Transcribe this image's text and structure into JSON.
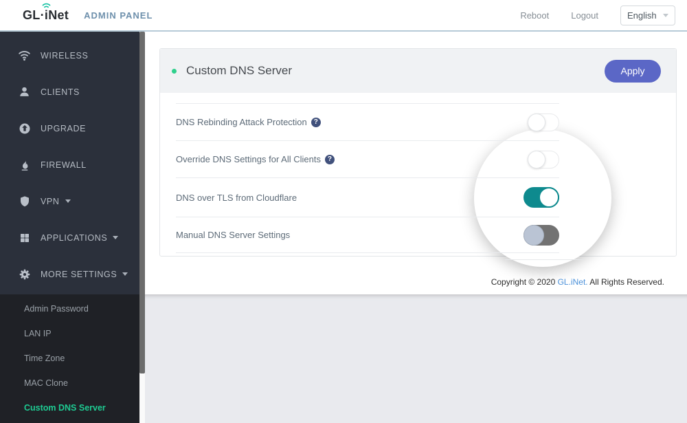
{
  "header": {
    "logo": {
      "text_gl": "GL·",
      "text_inet": "iNet"
    },
    "admin_panel": "ADMIN PANEL",
    "reboot": "Reboot",
    "logout": "Logout",
    "language": {
      "selected": "English"
    }
  },
  "sidebar": {
    "items": [
      {
        "label": "WIRELESS",
        "icon": "wifi",
        "caret": false
      },
      {
        "label": "CLIENTS",
        "icon": "person",
        "caret": false
      },
      {
        "label": "UPGRADE",
        "icon": "upgrade",
        "caret": false
      },
      {
        "label": "FIREWALL",
        "icon": "firewall",
        "caret": false
      },
      {
        "label": "VPN",
        "icon": "shield",
        "caret": true
      },
      {
        "label": "APPLICATIONS",
        "icon": "apps",
        "caret": true
      },
      {
        "label": "MORE SETTINGS",
        "icon": "gear",
        "caret": true
      }
    ],
    "submenu": [
      {
        "label": "Admin Password",
        "active": false
      },
      {
        "label": "LAN IP",
        "active": false
      },
      {
        "label": "Time Zone",
        "active": false
      },
      {
        "label": "MAC Clone",
        "active": false
      },
      {
        "label": "Custom DNS Server",
        "active": true
      }
    ]
  },
  "main": {
    "card": {
      "title": "Custom DNS Server",
      "apply_label": "Apply",
      "rows": [
        {
          "label": "DNS Rebinding Attack Protection",
          "help": true,
          "help_glyph": "?",
          "toggle": "off"
        },
        {
          "label": "Override DNS Settings for All Clients",
          "help": true,
          "help_glyph": "?",
          "toggle": "off"
        },
        {
          "label": "DNS over TLS from Cloudflare",
          "help": false,
          "help_glyph": "",
          "toggle": "on"
        },
        {
          "label": "Manual DNS Server Settings",
          "help": false,
          "help_glyph": "",
          "toggle": "off-dark"
        }
      ]
    },
    "footer": {
      "pre": "Copyright © 2020 ",
      "link": "GL.iNet.",
      "post": " All Rights Reserved."
    }
  },
  "colors": {
    "toggle_on_teal": "#0e8a8e",
    "toggle_off_dark_track": "#727272",
    "apply_button_indigo": "#5b67c6",
    "active_menu_green": "#1ecb92",
    "header_status_dot_green": "#2fd08c",
    "brand_wifi_teal": "#16c2a3",
    "help_icon_navy": "#41517c",
    "footer_link_blue": "#4a90d9",
    "sidebar_bg": "#2b303b",
    "submenu_bg": "#1f2126"
  }
}
